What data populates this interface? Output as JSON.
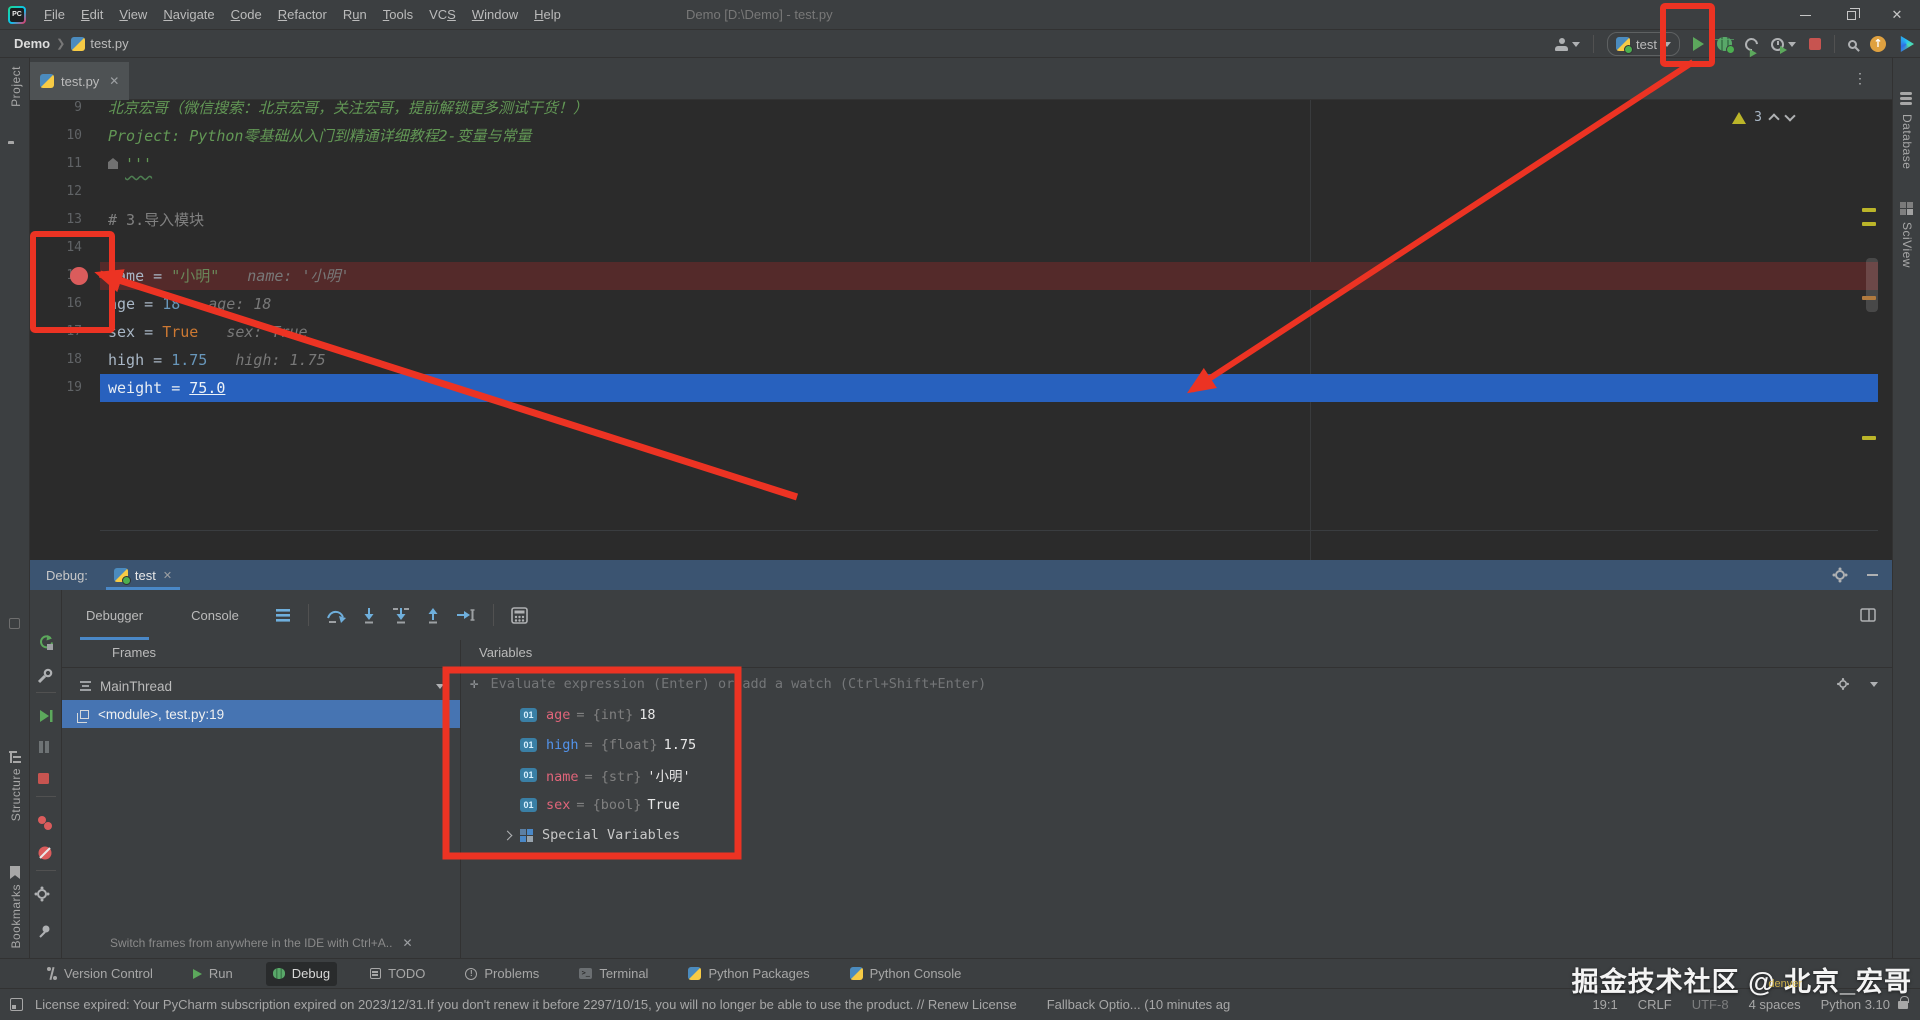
{
  "colors": {
    "annotation_red": "#EC3323",
    "execution_line_blue": "#2861BE",
    "breakpoint_line_red": "#542A2A",
    "selection_blue": "#4674B2",
    "tab_accent_blue": "#4A88C7"
  },
  "title_bar": {
    "title": "Demo [D:\\Demo] - test.py",
    "menus": [
      {
        "label": "File",
        "hot": 0
      },
      {
        "label": "Edit",
        "hot": 0
      },
      {
        "label": "View",
        "hot": 0
      },
      {
        "label": "Navigate",
        "hot": 0
      },
      {
        "label": "Code",
        "hot": 0
      },
      {
        "label": "Refactor",
        "hot": 0
      },
      {
        "label": "Run",
        "hot": 1
      },
      {
        "label": "Tools",
        "hot": 0
      },
      {
        "label": "VCS",
        "hot": 2
      },
      {
        "label": "Window",
        "hot": 0
      },
      {
        "label": "Help",
        "hot": 0
      }
    ]
  },
  "nav_bar": {
    "project": "Demo",
    "file": "test.py",
    "run_config": "test"
  },
  "editor": {
    "tab_label": "test.py",
    "warning_count": "3",
    "lines": [
      {
        "num": "9",
        "tokens": [
          {
            "t": "北京宏哥（微信搜索：北京宏哥，关注宏哥，提前解锁更多测试干货！）",
            "c": "doc"
          }
        ]
      },
      {
        "num": "10",
        "tokens": [
          {
            "t": "Project: Python零基础从入门到精通详细教程2-变量与常量",
            "c": "doc"
          }
        ]
      },
      {
        "num": "11",
        "tokens": [
          {
            "t": "",
            "c": "marker"
          },
          {
            "t": "'''",
            "c": "doc squig"
          }
        ]
      },
      {
        "num": "12",
        "tokens": []
      },
      {
        "num": "13",
        "tokens": [
          {
            "t": "# 3.导入模块",
            "c": "cmt"
          }
        ]
      },
      {
        "num": "14",
        "tokens": []
      },
      {
        "num": "15",
        "bg": "brk",
        "bp": true,
        "tokens": [
          {
            "t": "name = ",
            "c": "plain"
          },
          {
            "t": "\"小明\"",
            "c": "str"
          }
        ],
        "hint": "name: '小明'"
      },
      {
        "num": "16",
        "tokens": [
          {
            "t": "age = ",
            "c": "plain"
          },
          {
            "t": "18",
            "c": "num"
          }
        ],
        "hint": "age: 18"
      },
      {
        "num": "17",
        "tokens": [
          {
            "t": "sex = ",
            "c": "plain"
          },
          {
            "t": "True",
            "c": "kw"
          }
        ],
        "hint": "sex: True"
      },
      {
        "num": "18",
        "tokens": [
          {
            "t": "high = ",
            "c": "plain"
          },
          {
            "t": "1.75",
            "c": "num"
          }
        ],
        "hint": "high: 1.75"
      },
      {
        "num": "19",
        "bg": "exec",
        "tokens": [
          {
            "t": "weight = ",
            "c": "plain"
          },
          {
            "t": "75.0",
            "c": "link"
          }
        ]
      }
    ]
  },
  "left_stripe": {
    "top": "Project",
    "bottom": [
      "Structure",
      "Bookmarks"
    ]
  },
  "right_stripe": {
    "items": [
      "Database",
      "SciView"
    ]
  },
  "debug": {
    "label": "Debug:",
    "tab": "test",
    "tabs": [
      "Debugger",
      "Console"
    ],
    "frames_header": "Frames",
    "variables_header": "Variables",
    "thread": "MainThread",
    "frame": "<module>, test.py:19",
    "hint": "Switch frames from anywhere in the IDE with Ctrl+A..",
    "watch_placeholder": "Evaluate expression (Enter) or add a watch (Ctrl+Shift+Enter)",
    "variables": [
      {
        "name": "age",
        "type": "= {int}",
        "value": "18",
        "style": "pink",
        "icon": "prim"
      },
      {
        "name": "high",
        "type": "= {float}",
        "value": "1.75",
        "style": "blue",
        "icon": "prim"
      },
      {
        "name": "name",
        "type": "= {str}",
        "value": "'小明'",
        "style": "pink",
        "icon": "prim"
      },
      {
        "name": "sex",
        "type": "= {bool}",
        "value": "True",
        "style": "pink",
        "icon": "prim"
      },
      {
        "label": "Special Variables",
        "icon": "grid",
        "chevron": true
      }
    ]
  },
  "bottom_bar": {
    "items": [
      {
        "label": "Version Control",
        "icon": "branch"
      },
      {
        "label": "Run",
        "icon": "run"
      },
      {
        "label": "Debug",
        "icon": "bug",
        "active": true
      },
      {
        "label": "TODO",
        "icon": "todo"
      },
      {
        "label": "Problems",
        "icon": "problems"
      },
      {
        "label": "Terminal",
        "icon": "terminal"
      },
      {
        "label": "Python Packages",
        "icon": "python"
      },
      {
        "label": "Python Console",
        "icon": "python"
      }
    ]
  },
  "status_bar": {
    "license": "License expired: Your PyCharm subscription expired on 2023/12/31.If you don't renew it before 2297/10/15, you will no longer be able to use the product. // Renew License",
    "fallback": "Fallback Optio... (10 minutes ag",
    "right": [
      "19:1",
      "CRLF",
      "UTF-8",
      "4 spaces",
      "Python 3.10"
    ]
  },
  "watermark": {
    "text": "掘金技术社区 @ 北京_宏哥",
    "small": "denver"
  }
}
